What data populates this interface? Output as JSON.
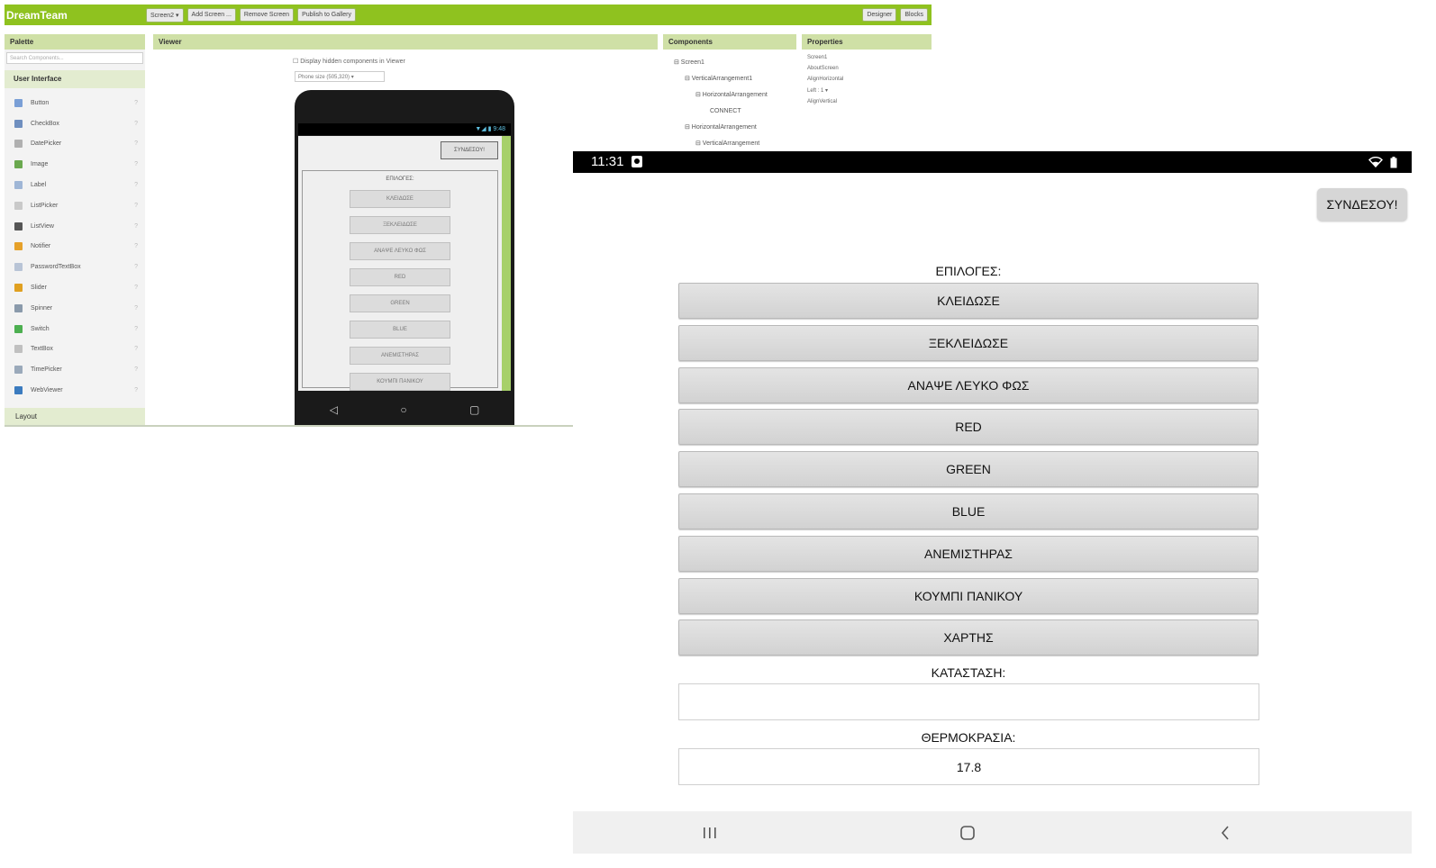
{
  "designer": {
    "app_name": "DreamTeam",
    "toolbar": [
      "Screen2 ▾",
      "Add Screen ...",
      "Remove Screen",
      "Publish to Gallery"
    ],
    "right_buttons": [
      "Designer",
      "Blocks"
    ],
    "palette_title": "Palette",
    "search_placeholder": "Search Components...",
    "palette_category": "User Interface",
    "palette_items": [
      {
        "label": "Button",
        "color": "#7a9fd6"
      },
      {
        "label": "CheckBox",
        "color": "#6f8fbf"
      },
      {
        "label": "DatePicker",
        "color": "#b0b0b0"
      },
      {
        "label": "Image",
        "color": "#6aa84f"
      },
      {
        "label": "Label",
        "color": "#9fb6d6"
      },
      {
        "label": "ListPicker",
        "color": "#c9c9c9"
      },
      {
        "label": "ListView",
        "color": "#555555"
      },
      {
        "label": "Notifier",
        "color": "#e6a12a"
      },
      {
        "label": "PasswordTextBox",
        "color": "#b8c4d6"
      },
      {
        "label": "Slider",
        "color": "#e0a020"
      },
      {
        "label": "Spinner",
        "color": "#8a9aab"
      },
      {
        "label": "Switch",
        "color": "#4caf50"
      },
      {
        "label": "TextBox",
        "color": "#c0c0c0"
      },
      {
        "label": "TimePicker",
        "color": "#9aa9ba"
      },
      {
        "label": "WebViewer",
        "color": "#3b7bbf"
      }
    ],
    "palette_layout": "Layout",
    "viewer_title": "Viewer",
    "viewer_hidden": "Display hidden components in Viewer",
    "viewer_size": "Phone size (505,320) ▾",
    "phone_time": "9:48",
    "phone_connect": "ΣΥΝΔΕΣΟΥ!",
    "phone_title": "ΕΠΙΛΟΓΕΣ:",
    "phone_buttons": [
      "ΚΛΕΙΔΩΣΕ",
      "ΞΕΚΛΕΙΔΩΣΕ",
      "ΑΝΑΨΕ ΛΕΥΚΟ ΦΩΣ",
      "RED",
      "GREEN",
      "BLUE",
      "ΑΝΕΜΙΣΤΗΡΑΣ",
      "ΚΟΥΜΠΙ ΠΑΝΙΚΟΥ"
    ],
    "components_title": "Components",
    "components_tree": [
      "⊟ Screen1",
      "⊟ VerticalArrangement1",
      "⊟ HorizontalArrangement",
      "CONNECT",
      "⊟ HorizontalArrangement",
      "⊟ VerticalArrangement"
    ],
    "properties_title": "Properties",
    "properties_lines": [
      "Screen1",
      "AboutScreen",
      "AlignHorizontal",
      "Left : 1 ▾",
      "AlignVertical"
    ]
  },
  "tablet": {
    "status_time": "11:31",
    "connect_label": "ΣΥΝΔΕΣΟΥ!",
    "options_label": "ΕΠΙΛΟΓΕΣ:",
    "buttons": [
      "ΚΛΕΙΔΩΣΕ",
      "ΞΕΚΛΕΙΔΩΣΕ",
      "ΑΝΑΨΕ ΛΕΥΚΟ ΦΩΣ",
      "RED",
      "GREEN",
      "BLUE",
      "ΑΝΕΜΙΣΤΗΡΑΣ",
      "ΚΟΥΜΠΙ ΠΑΝΙΚΟΥ",
      "ΧΑΡΤΗΣ"
    ],
    "status_label": "ΚΑΤΑΣΤΑΣΗ:",
    "status_value": "",
    "temperature_label": "ΘΕΡΜΟΚΡΑΣΙΑ:",
    "temperature_value": "17.8",
    "nav": {
      "recents": "recents-icon",
      "home": "home-icon",
      "back": "back-icon"
    }
  },
  "colors": {
    "ai_green": "#8fc21f",
    "panel_header": "#cfe0a6",
    "button_gray": "#d6d6d6",
    "status_bar": "#000000",
    "nav_bar": "#f0f0f0"
  }
}
